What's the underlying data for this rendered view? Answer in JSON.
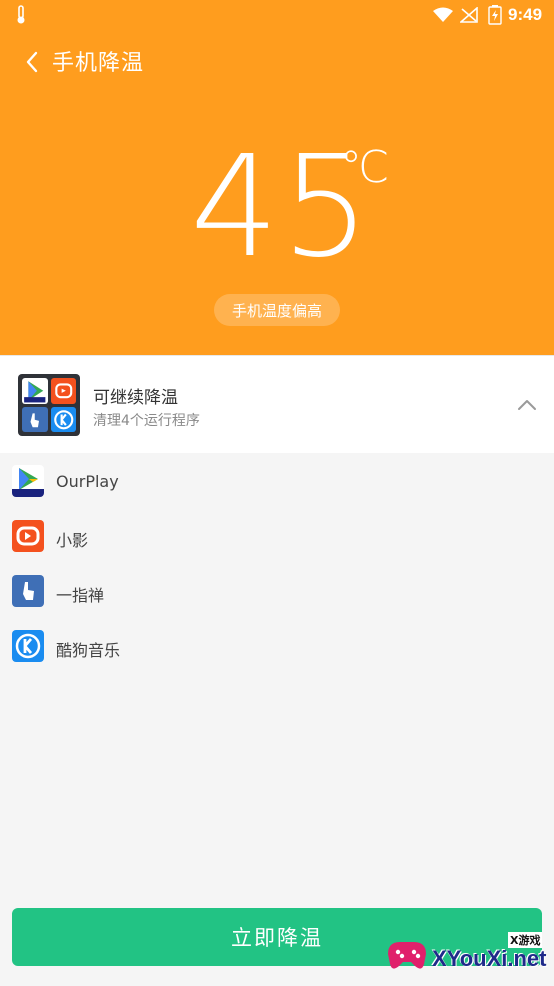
{
  "status_bar": {
    "time": "9:49",
    "icons": [
      "thermometer-icon",
      "wifi-icon",
      "signal-icon",
      "battery-icon"
    ]
  },
  "header": {
    "title": "手机降温",
    "temperature": "45",
    "unit": "℃",
    "status": "手机温度偏高"
  },
  "summary": {
    "title": "可继续降温",
    "subtitle": "清理4个运行程序"
  },
  "apps": [
    {
      "name": "OurPlay",
      "icon": "ourplay-icon"
    },
    {
      "name": "小影",
      "icon": "xiaoying-icon"
    },
    {
      "name": "一指禅",
      "icon": "yizhichan-icon"
    },
    {
      "name": "酷狗音乐",
      "icon": "kugou-icon"
    }
  ],
  "action": {
    "label": "立即降温"
  },
  "watermark": {
    "tag": "X游戏",
    "text": "XYouXi.net"
  },
  "colors": {
    "header": "#ff9d1e",
    "primary_button": "#22c384",
    "background": "#f5f5f5"
  }
}
